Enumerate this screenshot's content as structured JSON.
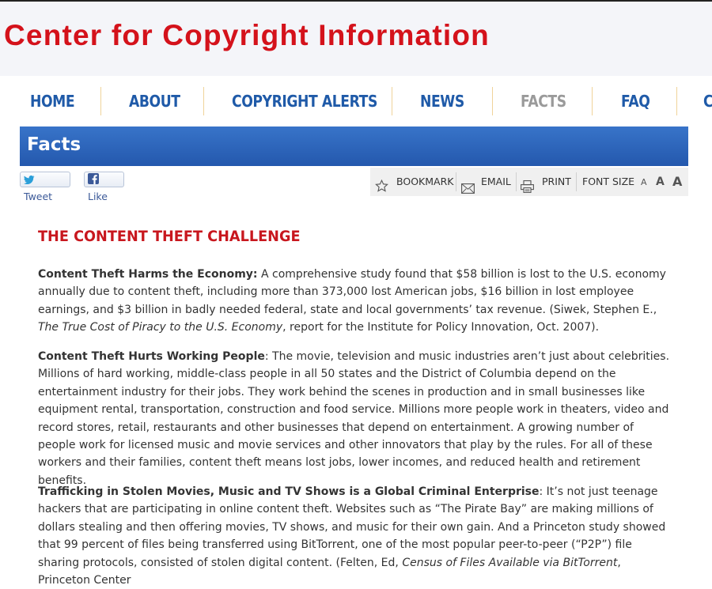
{
  "site": {
    "title": "Center for Copyright Information"
  },
  "nav": {
    "items": [
      {
        "label": "HOME"
      },
      {
        "label": "ABOUT"
      },
      {
        "label": "COPYRIGHT ALERTS"
      },
      {
        "label": "NEWS"
      },
      {
        "label": "FACTS"
      },
      {
        "label": "FAQ"
      },
      {
        "label": "C"
      }
    ],
    "current_color": "#9a9a9a",
    "link_color": "#1f5aa8"
  },
  "page": {
    "title": "Facts"
  },
  "social": {
    "tweet_label": "Tweet",
    "like_label": "Like"
  },
  "toolbar": {
    "bookmark_label": "BOOKMARK",
    "email_label": "EMAIL",
    "print_label": "PRINT",
    "font_size_label": "FONT SIZE",
    "font_small": "A",
    "font_medium": "A",
    "font_large": "A"
  },
  "article": {
    "heading": "THE CONTENT THEFT CHALLENGE",
    "p1": {
      "lead": "Content Theft Harms the Economy:",
      "text1": " A comprehensive study found that $58 billion is lost to the U.S. economy annually due to content theft, including more than 373,000 lost American jobs, $16 billion in lost employee earnings, and $3 billion in badly needed federal, state and local governments’ tax revenue. (Siwek,  Stephen E., ",
      "cite": "The True Cost of Piracy to the U.S. Economy",
      "text2": ", report for the Institute for Policy Innovation, Oct. 2007)."
    },
    "p2": {
      "lead": "Content Theft Hurts Working People",
      "text1": ": The movie, television and music industries aren’t just about celebrities. Millions of hard working, middle-class people in all 50 states and the District of Columbia depend on the entertainment industry for their jobs.  They work behind the scenes in production and in small businesses like equipment rental, transportation, construction and food service.  Millions more people work in theaters, video and record stores, retail, restaurants and other businesses that depend on entertainment.  A growing number of people work for licensed music and movie services and other innovators that play by the rules.  For all of these workers and their families, content theft means lost jobs, lower incomes, and reduced health and retirement benefits."
    },
    "p3": {
      "lead": "Trafficking in Stolen Movies, Music and TV Shows is a Global Criminal Enterprise",
      "text1": ":  It’s not just teenage hackers that are participating in online content theft. Websites such as “The Pirate Bay” are making millions of dollars stealing and then offering movies, TV shows, and music for their own gain.  And a Princeton study showed that 99 percent of files being transferred using BitTorrent, one of the most popular peer-to-peer (“P2P”) file sharing protocols, consisted of stolen digital content. (Felten, Ed, ",
      "cite": "Census of Files Available via BitTorrent",
      "text2": ", Princeton Center"
    }
  }
}
